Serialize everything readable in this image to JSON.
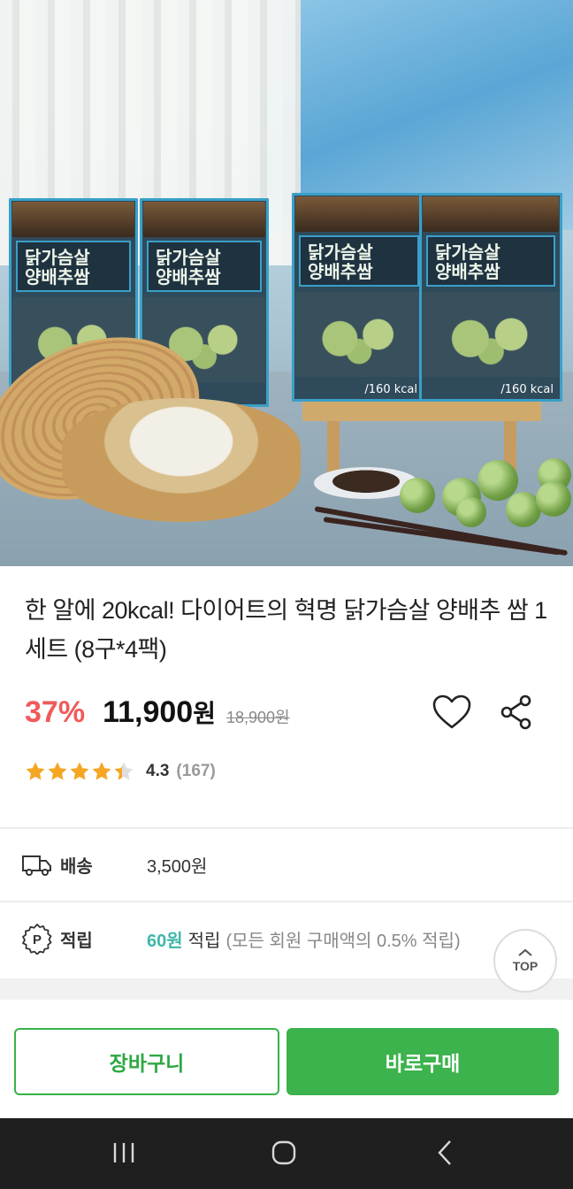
{
  "product_image": {
    "box_label_line1": "닭가슴살",
    "box_label_line2": "양배추쌈",
    "box_kcal": "/160 kcal"
  },
  "product": {
    "title": "한 알에 20kcal! 다이어트의 혁명 닭가슴살 양배추 쌈 1세트 (8구*4팩)",
    "discount": "37%",
    "price": "11,900",
    "price_unit": "원",
    "original_price": "18,900원"
  },
  "rating": {
    "score": "4.3",
    "count": "(167)",
    "stars_filled": 4.3,
    "star_color": "#f5a623"
  },
  "shipping": {
    "label": "배송",
    "value": "3,500원"
  },
  "points": {
    "label": "적립",
    "amount": "60원",
    "word": "적립",
    "note": "(모든 회원 구매액의 0.5% 적립)"
  },
  "top_button": {
    "label": "TOP"
  },
  "actions": {
    "cart_label": "장바구니",
    "buy_label": "바로구매"
  },
  "colors": {
    "accent_green": "#3cb34d",
    "discount_red": "#f05a5a",
    "points_teal": "#3fb6a8"
  },
  "icons": {
    "heart": "heart-icon",
    "share": "share-icon",
    "delivery": "truck-icon",
    "points": "point-badge-icon",
    "top": "chevron-up-icon",
    "nav_recent": "recent-apps-icon",
    "nav_home": "home-icon",
    "nav_back": "back-icon"
  }
}
